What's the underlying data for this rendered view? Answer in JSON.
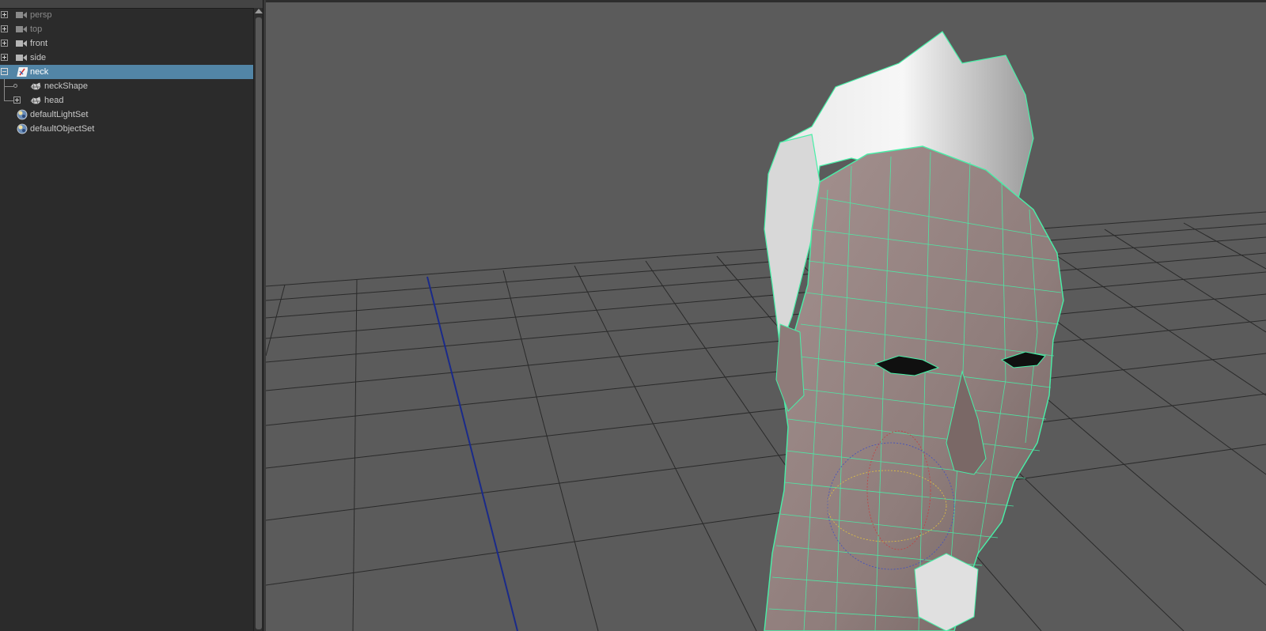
{
  "outliner": {
    "items": [
      {
        "label": "persp",
        "icon": "camera-icon",
        "expander": "plus",
        "dim": true
      },
      {
        "label": "top",
        "icon": "camera-icon",
        "expander": "plus",
        "dim": true
      },
      {
        "label": "front",
        "icon": "camera-icon",
        "expander": "plus",
        "dim": false
      },
      {
        "label": "side",
        "icon": "camera-icon",
        "expander": "plus",
        "dim": false
      },
      {
        "label": "neck",
        "icon": "transform-icon",
        "expander": "minus",
        "selected": true
      },
      {
        "label": "neckShape",
        "icon": "mesh-shape-icon"
      },
      {
        "label": "head",
        "icon": "mesh-shape-icon",
        "expander": "plus"
      },
      {
        "label": "defaultLightSet",
        "icon": "set-icon"
      },
      {
        "label": "defaultObjectSet",
        "icon": "set-icon"
      }
    ]
  },
  "viewport": {
    "background": "#5b5b5b",
    "grid_color": "#2a2a2a",
    "z_axis_color": "#1a2a8a",
    "wireframe_color": "#48f0a8",
    "selection_color": "#5285a6"
  }
}
